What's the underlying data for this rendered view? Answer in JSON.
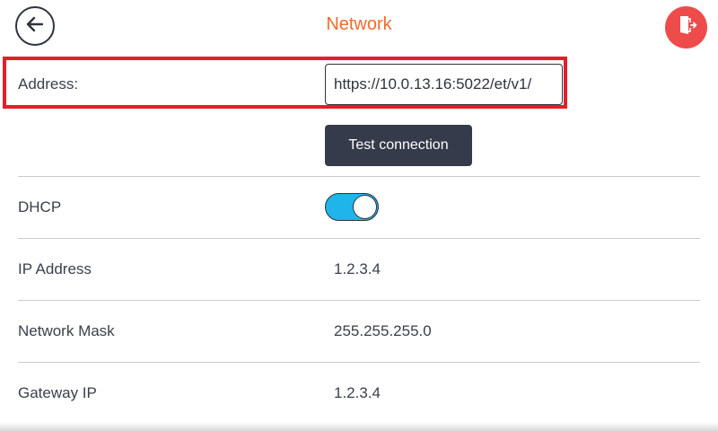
{
  "header": {
    "title": "Network",
    "back_icon": "arrow-left-icon",
    "exit_icon": "exit-door-icon"
  },
  "address": {
    "label": "Address:",
    "value": "https://10.0.13.16:5022/et/v1/"
  },
  "test_connection": {
    "label": "Test connection"
  },
  "dhcp": {
    "label": "DHCP",
    "enabled": true
  },
  "ip_address": {
    "label": "IP Address",
    "value": "1.2.3.4"
  },
  "network_mask": {
    "label": "Network Mask",
    "value": "255.255.255.0"
  },
  "gateway_ip": {
    "label": "Gateway IP",
    "value": "1.2.3.4"
  },
  "colors": {
    "title": "#f26a2e",
    "exit_button": "#ee4b4b",
    "highlight": "#e0202a",
    "toggle_on": "#1fb5ea",
    "button_dark": "#353b4a"
  }
}
